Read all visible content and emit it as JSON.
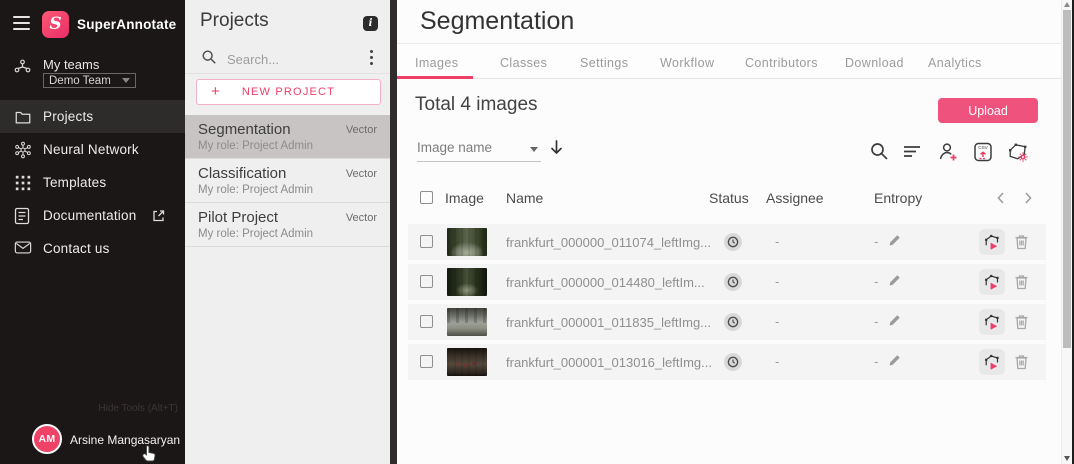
{
  "accent": "#ee3f68",
  "sidebar": {
    "brand": "SuperAnnotate",
    "logo_letter": "S",
    "teams_label": "My teams",
    "team_select": "Demo Team",
    "items": [
      {
        "label": "Projects"
      },
      {
        "label": "Neural Network"
      },
      {
        "label": "Templates"
      },
      {
        "label": "Documentation"
      },
      {
        "label": "Contact us"
      }
    ],
    "hide_tools": "Hide Tools (Alt+T)",
    "user": {
      "initials": "AM",
      "name": "Arsine Mangasaryan"
    }
  },
  "panel": {
    "title": "Projects",
    "info": "i",
    "search_placeholder": "Search...",
    "new_project_label": "NEW PROJECT",
    "projects": [
      {
        "name": "Segmentation",
        "type": "Vector",
        "role": "My role: Project Admin"
      },
      {
        "name": "Classification",
        "type": "Vector",
        "role": "My role: Project Admin"
      },
      {
        "name": "Pilot Project",
        "type": "Vector",
        "role": "My role: Project Admin"
      }
    ]
  },
  "main": {
    "title": "Segmentation",
    "tabs": [
      "Images",
      "Classes",
      "Settings",
      "Workflow",
      "Contributors",
      "Download",
      "Analytics"
    ],
    "active_tab": "Images",
    "total_label": "Total 4 images",
    "upload_label": "Upload",
    "sort_by": "Image name",
    "table": {
      "headers": {
        "image": "Image",
        "name": "Name",
        "status": "Status",
        "assignee": "Assignee",
        "entropy": "Entropy"
      },
      "rows": [
        {
          "name": "frankfurt_000000_011074_leftImg...",
          "status": "pending",
          "assignee": "-",
          "entropy": "-"
        },
        {
          "name": "frankfurt_000000_014480_leftIm...",
          "status": "pending",
          "assignee": "-",
          "entropy": "-"
        },
        {
          "name": "frankfurt_000001_011835_leftImg...",
          "status": "pending",
          "assignee": "-",
          "entropy": "-"
        },
        {
          "name": "frankfurt_000001_013016_leftImg...",
          "status": "pending",
          "assignee": "-",
          "entropy": "-"
        }
      ]
    }
  }
}
